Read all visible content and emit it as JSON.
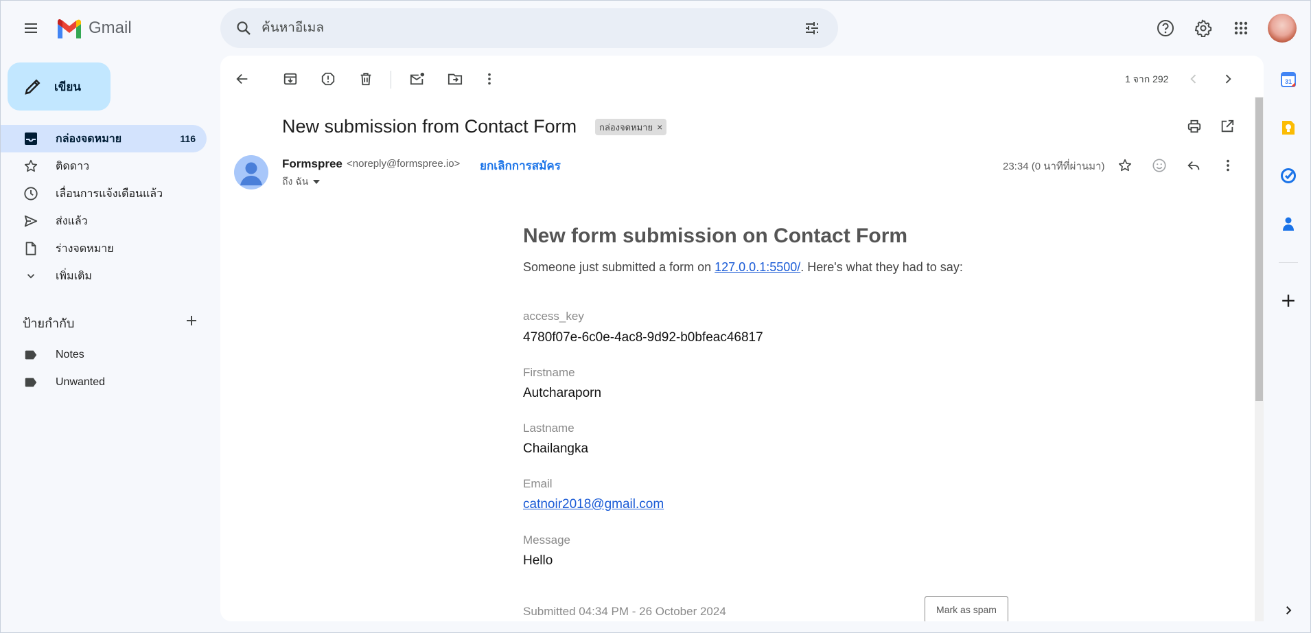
{
  "app": {
    "logo_text": "Gmail"
  },
  "search": {
    "placeholder": "ค้นหาอีเมล"
  },
  "compose": {
    "label": "เขียน"
  },
  "nav": {
    "items": [
      {
        "label": "กล่องจดหมาย",
        "count": "116",
        "icon": "inbox-icon",
        "active": true
      },
      {
        "label": "ติดดาว",
        "icon": "star-icon"
      },
      {
        "label": "เลื่อนการแจ้งเตือนแล้ว",
        "icon": "clock-icon"
      },
      {
        "label": "ส่งแล้ว",
        "icon": "send-icon"
      },
      {
        "label": "ร่างจดหมาย",
        "icon": "draft-icon"
      },
      {
        "label": "เพิ่มเติม",
        "icon": "chevron-down-icon"
      }
    ],
    "labels_title": "ป้ายกำกับ",
    "labels": [
      {
        "label": "Notes",
        "icon": "label-icon"
      },
      {
        "label": "Unwanted",
        "icon": "label-icon"
      }
    ]
  },
  "toolbar": {
    "pager": "1 จาก 292"
  },
  "message": {
    "subject": "New submission from Contact Form",
    "chip": "กล่องจดหมาย",
    "chip_close": "×",
    "sender_name": "Formspree",
    "sender_email": "<noreply@formspree.io>",
    "unsubscribe": "ยกเลิกการสมัคร",
    "to": "ถึง ฉัน",
    "time": "23:34 (0 นาทีที่ผ่านมา)"
  },
  "body": {
    "title": "New form submission on Contact Form",
    "intro_before": "Someone just submitted a form on ",
    "intro_link": "127.0.0.1:5500/",
    "intro_after": ". Here's what they had to say:",
    "fields": [
      {
        "label": "access_key",
        "value": "4780f07e-6c0e-4ac8-9d92-b0bfeac46817"
      },
      {
        "label": "Firstname",
        "value": "Autcharaporn"
      },
      {
        "label": "Lastname",
        "value": "Chailangka"
      },
      {
        "label": "Email",
        "value": "catnoir2018@gmail.com"
      },
      {
        "label": "Message",
        "value": "Hello"
      }
    ],
    "submitted": "Submitted 04:34 PM - 26 October 2024",
    "spam_button": "Mark as spam"
  },
  "colors": {
    "accent": "#1a73e8",
    "compose_bg": "#c2e7ff",
    "active_nav_bg": "#d3e3fd",
    "page_bg": "#f6f8fc"
  }
}
